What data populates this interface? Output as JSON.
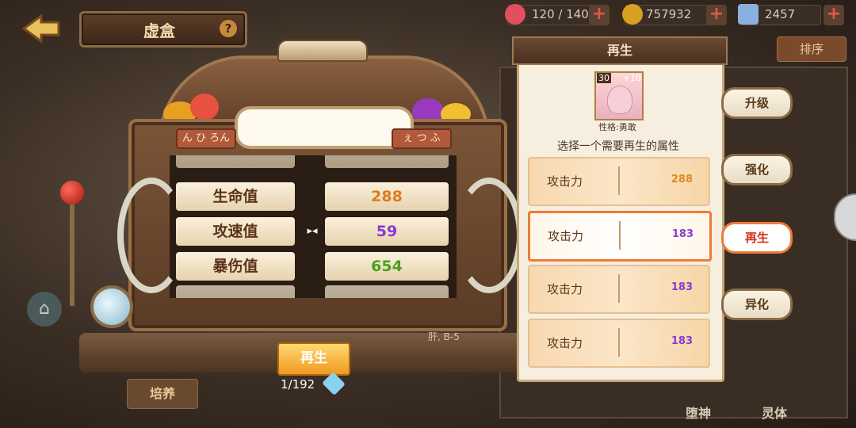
{
  "header": {
    "title": "虚盒",
    "help": "?",
    "resources": [
      {
        "name": "stamina",
        "value": "120 / 140",
        "icon": "heart-icon",
        "color": "#e05060"
      },
      {
        "name": "gold",
        "value": "757932",
        "icon": "coin-icon",
        "color": "#d8a020"
      },
      {
        "name": "gems",
        "value": "2457",
        "icon": "crystal-icon",
        "color": "#8ab0e0"
      }
    ],
    "plus": "+"
  },
  "sort_button": "排序",
  "machine": {
    "tag_left": "ん ひ ろん",
    "tag_right": "ぇ つ ふ",
    "stats": [
      {
        "name": "生命值",
        "value": "288",
        "color": "#e07a20"
      },
      {
        "name": "攻速值",
        "value": "59",
        "color": "#8a3ad0"
      },
      {
        "name": "暴伤值",
        "value": "654",
        "color": "#4aa020"
      }
    ],
    "cursor": "▸◂"
  },
  "bottom": {
    "regen_button": "再生",
    "count": "1/192",
    "cultivate": "培养",
    "bg_text": "肝, B-5"
  },
  "panel": {
    "header": "再生",
    "card_level": "30",
    "card_plus": "+10",
    "personality": "性格:勇敢",
    "instruction": "选择一个需要再生的属性",
    "options": [
      {
        "label": "攻击力",
        "value": "288",
        "color": "#e08a20",
        "selected": false
      },
      {
        "label": "攻击力",
        "value": "183",
        "color": "#8a3ad0",
        "selected": true
      },
      {
        "label": "攻击力",
        "value": "183",
        "color": "#8a3ad0",
        "selected": false
      },
      {
        "label": "攻击力",
        "value": "183",
        "color": "#8a3ad0",
        "selected": false
      }
    ]
  },
  "side_buttons": [
    "升级",
    "强化",
    "再生",
    "异化"
  ],
  "bottom_tabs": [
    "堕神",
    "灵体"
  ]
}
